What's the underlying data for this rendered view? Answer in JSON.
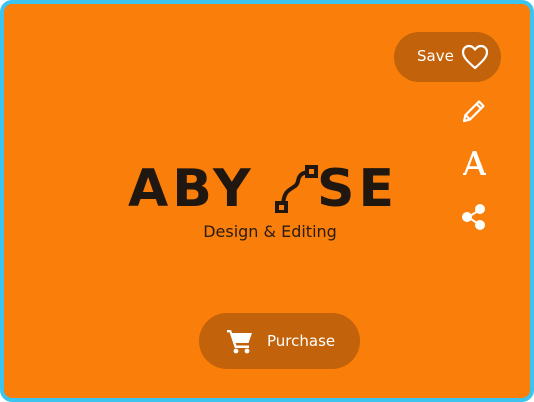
{
  "actions": {
    "save_label": "Save",
    "purchase_label": "Purchase"
  },
  "icons": {
    "save": "heart-icon",
    "edit": "pencil-icon",
    "font": "font-a-icon",
    "share": "share-icon",
    "cart": "cart-icon",
    "logo_mark": "bezier-path-icon"
  },
  "logo": {
    "left": "ABY",
    "right": "SE",
    "tagline": "Design & Editing"
  },
  "colors": {
    "background": "#f97e0a",
    "button": "#c2620a",
    "border": "#3cc4ee",
    "logo_text": "#201710",
    "icon": "#ffffff"
  }
}
